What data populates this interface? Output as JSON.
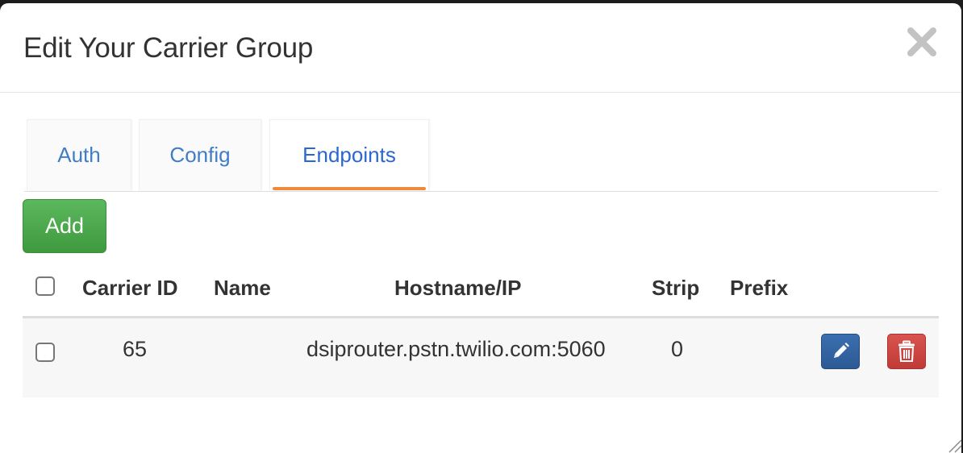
{
  "modal": {
    "title": "Edit Your Carrier Group",
    "close_icon": "close-icon"
  },
  "tabs": [
    {
      "label": "Auth",
      "active": false
    },
    {
      "label": "Config",
      "active": false
    },
    {
      "label": "Endpoints",
      "active": true
    }
  ],
  "toolbar": {
    "add_label": "Add"
  },
  "table": {
    "columns": [
      "Carrier ID",
      "Name",
      "Hostname/IP",
      "Strip",
      "Prefix"
    ],
    "rows": [
      {
        "carrier_id": "65",
        "name": "",
        "hostname": "dsiprouter.pstn.twilio.com:5060",
        "strip": "0",
        "prefix": "",
        "edit_icon": "pencil-icon",
        "delete_icon": "trash-icon"
      }
    ]
  },
  "colors": {
    "tab_text": "#3f7ec7",
    "active_tab_text": "#2a67d1",
    "active_tab_underline": "#f08a3a",
    "add_button": "#5cb85c",
    "edit_button": "#2c5a94",
    "delete_button": "#c9302c"
  }
}
